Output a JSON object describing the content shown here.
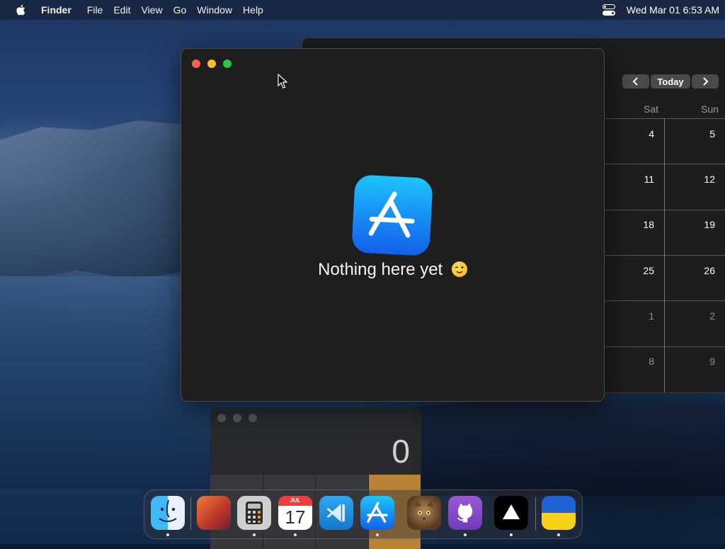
{
  "menubar": {
    "app_name": "Finder",
    "items": [
      "File",
      "Edit",
      "View",
      "Go",
      "Window",
      "Help"
    ],
    "datetime": "Wed Mar 01  6:53 AM"
  },
  "calendar": {
    "nav": {
      "today_label": "Today"
    },
    "weekday_headers": [
      "Sat",
      "Sun"
    ],
    "rows": [
      {
        "sat": "4",
        "sun": "5",
        "dim": false
      },
      {
        "sat": "11",
        "sun": "12",
        "dim": false
      },
      {
        "sat": "18",
        "sun": "19",
        "dim": false
      },
      {
        "sat": "25",
        "sun": "26",
        "dim": false
      },
      {
        "sat": "1",
        "sun": "2",
        "dim": true
      },
      {
        "sat": "8",
        "sun": "9",
        "dim": true
      }
    ]
  },
  "main_window": {
    "empty_message": "Nothing here yet"
  },
  "calculator": {
    "display": "0"
  },
  "dock": {
    "calendar_month": "JUL",
    "calendar_day": "17"
  },
  "colors": {
    "close": "#fe5f57",
    "minimize": "#febc2e",
    "maximize": "#28c840",
    "appstore_blue": "#178af5"
  }
}
